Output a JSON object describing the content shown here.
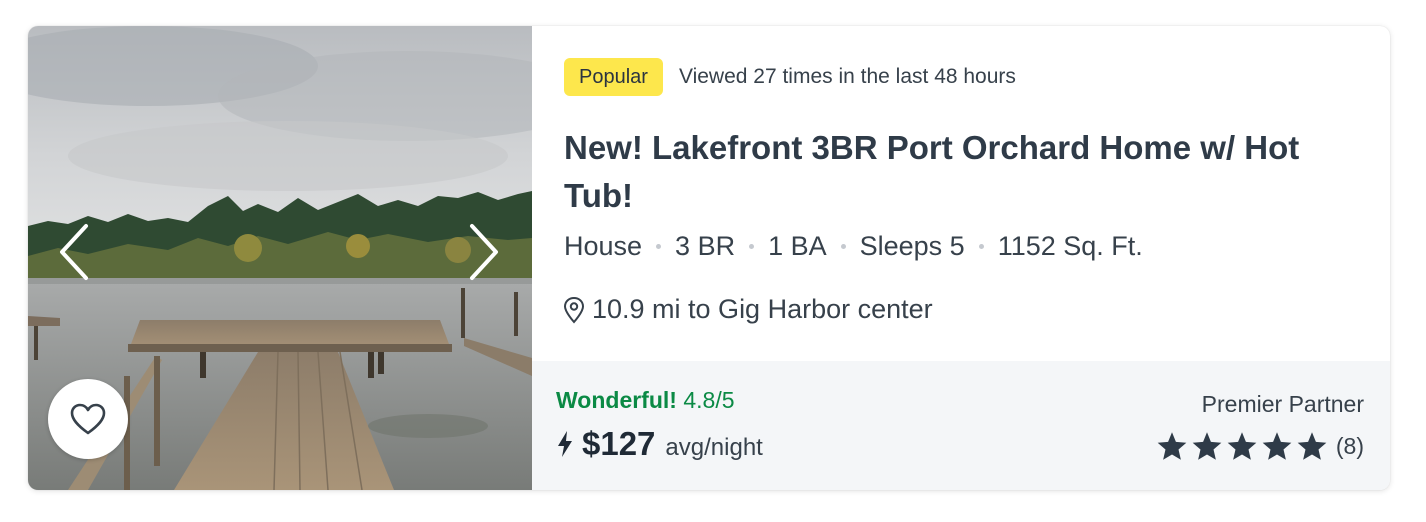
{
  "listing": {
    "badge": "Popular",
    "views_text": "Viewed 27 times in the last 48 hours",
    "title": "New! Lakefront 3BR Port Orchard Home w/ Hot Tub!",
    "specs": {
      "type": "House",
      "bedrooms": "3 BR",
      "bathrooms": "1 BA",
      "sleeps": "Sleeps 5",
      "area": "1152 Sq. Ft."
    },
    "location": "10.9 mi to Gig Harbor center"
  },
  "footer": {
    "rating_word": "Wonderful!",
    "rating_value": "4.8/5",
    "price": "$127",
    "price_unit": "avg/night",
    "partner_label": "Premier Partner",
    "star_rating": 5,
    "review_count": "(8)"
  },
  "icons": {
    "prev": "chevron-left-icon",
    "next": "chevron-right-icon",
    "favorite": "heart-icon",
    "location": "map-pin-icon",
    "instant_book": "lightning-bolt-icon",
    "rating": "star-icon"
  },
  "colors": {
    "badge_bg": "#fde74c",
    "rating_green": "#0b8a45",
    "title": "#2f3b48",
    "footer_bg": "#f4f6f8",
    "star": "#2f3b48"
  }
}
